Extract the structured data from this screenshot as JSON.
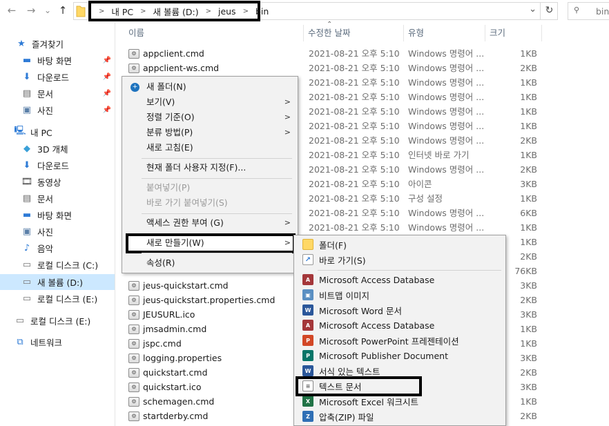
{
  "address": {
    "crumbs": [
      "내 PC",
      "새 볼륨 (D:)",
      "jeus",
      "bin"
    ],
    "search_placeholder": "bin"
  },
  "icons": {
    "back": "←",
    "forward": "→",
    "down": "⌄",
    "up": "↑",
    "chevron": "⌄",
    "refresh": "↻",
    "search": "🔍"
  },
  "nav": {
    "quick_access": "즐겨찾기",
    "quick_items": [
      "바탕 화면",
      "다운로드",
      "문서",
      "사진"
    ],
    "this_pc": "내 PC",
    "pc_items": [
      "3D 개체",
      "다운로드",
      "동영상",
      "문서",
      "바탕 화면",
      "사진",
      "음악",
      "로컬 디스크 (C:)",
      "새 볼륨 (D:)",
      "로컬 디스크 (E:)"
    ],
    "extra_drive": "로컬 디스크 (E:)",
    "network": "네트워크"
  },
  "columns": {
    "name": "이름",
    "date": "수정한 날짜",
    "type": "유형",
    "size": "크기"
  },
  "files": [
    {
      "name": "appclient.cmd",
      "date": "2021-08-21 오후 5:10",
      "type": "Windows 명령어 ...",
      "size": "1KB"
    },
    {
      "name": "appclient-ws.cmd",
      "date": "2021-08-21 오후 5:10",
      "type": "Windows 명령어 ...",
      "size": "2KB"
    },
    {
      "name": "",
      "date": "2021-08-21 오후 5:10",
      "type": "Windows 명령어 ...",
      "size": "1KB"
    },
    {
      "name": "",
      "date": "2021-08-21 오후 5:10",
      "type": "Windows 명령어 ...",
      "size": "1KB"
    },
    {
      "name": "",
      "date": "2021-08-21 오후 5:10",
      "type": "Windows 명령어 ...",
      "size": "1KB"
    },
    {
      "name": "",
      "date": "2021-08-21 오후 5:10",
      "type": "Windows 명령어 ...",
      "size": "1KB"
    },
    {
      "name": "",
      "date": "2021-08-21 오후 5:10",
      "type": "Windows 명령어 ...",
      "size": "2KB"
    },
    {
      "name": "",
      "date": "2021-08-21 오후 5:10",
      "type": "인터넷 바로 가기",
      "size": "1KB"
    },
    {
      "name": "",
      "date": "2021-08-21 오후 5:10",
      "type": "Windows 명령어 ...",
      "size": "2KB"
    },
    {
      "name": "",
      "date": "2021-08-21 오후 5:10",
      "type": "아이콘",
      "size": "3KB"
    },
    {
      "name": "",
      "date": "2021-08-21 오후 5:10",
      "type": "구성 설정",
      "size": "1KB"
    },
    {
      "name": "",
      "date": "2021-08-21 오후 5:10",
      "type": "Windows 명령어 ...",
      "size": "6KB"
    },
    {
      "name": "",
      "date": "2021-08-21 오후 5:10",
      "type": "Windows 명령어 ...",
      "size": "1KB"
    },
    {
      "name": "",
      "date": "",
      "type": "",
      "size": "1KB"
    },
    {
      "name": "",
      "date": "",
      "type": "",
      "size": "2KB"
    },
    {
      "name": "",
      "date": "",
      "type": "",
      "size": "76KB"
    },
    {
      "name": "jeus-quickstart.cmd",
      "date": "",
      "type": "",
      "size": "3KB"
    },
    {
      "name": "jeus-quickstart.properties.cmd",
      "date": "",
      "type": "",
      "size": "2KB"
    },
    {
      "name": "JEUSURL.ico",
      "date": "",
      "type": "",
      "size": "3KB"
    },
    {
      "name": "jmsadmin.cmd",
      "date": "",
      "type": "",
      "size": "1KB"
    },
    {
      "name": "jspc.cmd",
      "date": "",
      "type": "",
      "size": "1KB"
    },
    {
      "name": "logging.properties",
      "date": "",
      "type": "",
      "size": "3KB"
    },
    {
      "name": "quickstart.cmd",
      "date": "",
      "type": "",
      "size": "2KB"
    },
    {
      "name": "quickstart.ico",
      "date": "",
      "type": "",
      "size": "3KB"
    },
    {
      "name": "schemagen.cmd",
      "date": "",
      "type": "",
      "size": "1KB"
    },
    {
      "name": "startderby.cmd",
      "date": "",
      "type": "",
      "size": "2KB"
    }
  ],
  "context_menu": {
    "new_folder": "새 폴더(N)",
    "view": "보기(V)",
    "sort_by": "정렬 기준(O)",
    "group_by": "분류 방법(P)",
    "refresh": "새로 고침(E)",
    "customize": "현재 폴더 사용자 지정(F)...",
    "paste": "붙여넣기(P)",
    "paste_shortcut": "바로 가기 붙여넣기(S)",
    "give_access": "액세스 권한 부여 (G)",
    "new": "새로 만들기(W)",
    "properties": "속성(R)"
  },
  "submenu": {
    "folder": "폴더(F)",
    "shortcut": "바로 가기(S)",
    "items": [
      {
        "label": "Microsoft Access Database",
        "icon": "access-icon",
        "color": "#a4373a",
        "glyph": "A"
      },
      {
        "label": "비트맵 이미지",
        "icon": "bitmap-icon",
        "color": "#5a8fc2",
        "glyph": "▣"
      },
      {
        "label": "Microsoft Word 문서",
        "icon": "word-icon",
        "color": "#2b579a",
        "glyph": "W"
      },
      {
        "label": "Microsoft Access Database",
        "icon": "access-icon",
        "color": "#a4373a",
        "glyph": "A"
      },
      {
        "label": "Microsoft PowerPoint 프레젠테이션",
        "icon": "powerpoint-icon",
        "color": "#d24726",
        "glyph": "P"
      },
      {
        "label": "Microsoft Publisher Document",
        "icon": "publisher-icon",
        "color": "#077568",
        "glyph": "P"
      },
      {
        "label": "서식 있는 텍스트",
        "icon": "rtf-icon",
        "color": "#2b579a",
        "glyph": "W"
      },
      {
        "label": "텍스트 문서",
        "icon": "text-document-icon",
        "color": "#ffffff",
        "glyph": "≡"
      },
      {
        "label": "Microsoft Excel 워크시트",
        "icon": "excel-icon",
        "color": "#217346",
        "glyph": "X"
      },
      {
        "label": "압축(ZIP) 파일",
        "icon": "zip-icon",
        "color": "#2f6fb5",
        "glyph": "Z"
      }
    ]
  },
  "colors": {
    "selected_bg": "#cce8ff",
    "menu_bg": "#f2f2f2",
    "annotation": "#000000"
  }
}
